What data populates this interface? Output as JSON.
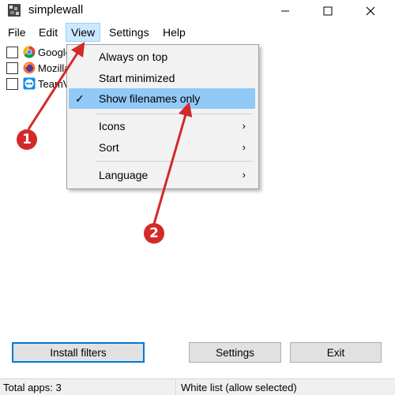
{
  "window": {
    "title": "simplewall"
  },
  "menubar": {
    "items": [
      {
        "label": "File"
      },
      {
        "label": "Edit"
      },
      {
        "label": "View"
      },
      {
        "label": "Settings"
      },
      {
        "label": "Help"
      }
    ]
  },
  "apps": [
    {
      "label": "Google",
      "icon": "chrome-icon"
    },
    {
      "label": "Mozilla",
      "icon": "firefox-icon"
    },
    {
      "label": "TeamV",
      "icon": "teamviewer-icon"
    }
  ],
  "view_menu": {
    "always_on_top": "Always on top",
    "start_minimized": "Start minimized",
    "show_filenames_only": "Show filenames only",
    "icons": "Icons",
    "sort": "Sort",
    "language": "Language"
  },
  "buttons": {
    "install_filters": "Install filters",
    "settings": "Settings",
    "exit": "Exit"
  },
  "status": {
    "total_apps": "Total apps: 3",
    "mode": "White list (allow selected)"
  },
  "annotations": {
    "step1": "1",
    "step2": "2"
  },
  "colors": {
    "accent": "#0078d7",
    "highlight": "#91c9f7",
    "annotation": "#d42929"
  }
}
